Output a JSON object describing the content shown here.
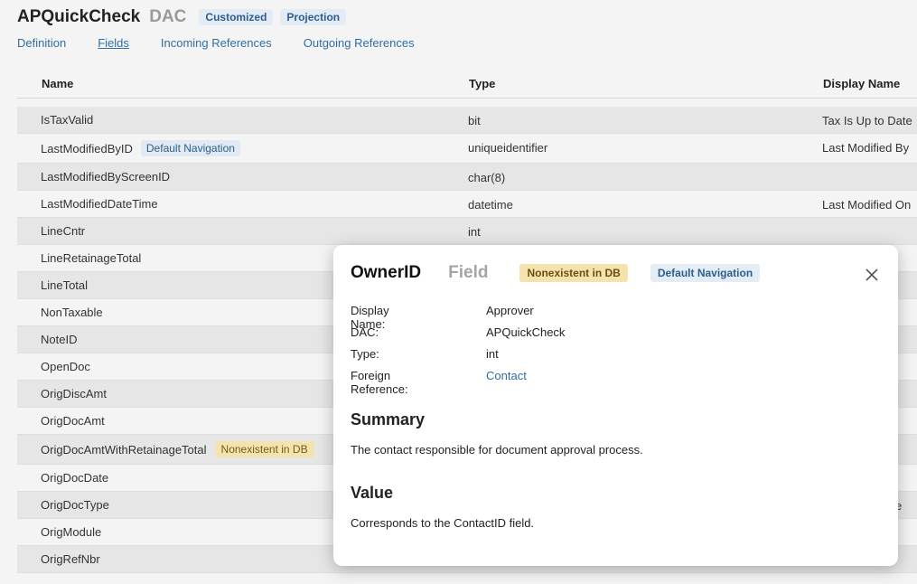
{
  "header": {
    "title": "APQuickCheck",
    "kind": "DAC",
    "tags": [
      "Customized",
      "Projection"
    ]
  },
  "tabs": [
    {
      "label": "Definition"
    },
    {
      "label": "Fields",
      "active": true
    },
    {
      "label": "Incoming References"
    },
    {
      "label": "Outgoing References"
    }
  ],
  "table": {
    "columns": [
      "Name",
      "Type",
      "Display Name"
    ],
    "rows": [
      {
        "name": "IsTaxValid",
        "badge": "",
        "type": "bit",
        "display": "Tax Is Up to Date"
      },
      {
        "name": "LastModifiedByID",
        "badge": "Default Navigation",
        "type": "uniqueidentifier",
        "display": "Last Modified By"
      },
      {
        "name": "LastModifiedByScreenID",
        "badge": "",
        "type": "char(8)",
        "display": ""
      },
      {
        "name": "LastModifiedDateTime",
        "badge": "",
        "type": "datetime",
        "display": "Last Modified On"
      },
      {
        "name": "LineCntr",
        "badge": "",
        "type": "int",
        "display": ""
      },
      {
        "name": "LineRetainageTotal",
        "badge": "",
        "type": "",
        "display": ""
      },
      {
        "name": "LineTotal",
        "badge": "",
        "type": "",
        "display": ""
      },
      {
        "name": "NonTaxable",
        "badge": "",
        "type": "",
        "display": ""
      },
      {
        "name": "NoteID",
        "badge": "",
        "type": "",
        "display": ""
      },
      {
        "name": "OpenDoc",
        "badge": "",
        "type": "",
        "display": ""
      },
      {
        "name": "OrigDiscAmt",
        "badge": "",
        "type": "",
        "display": ""
      },
      {
        "name": "OrigDocAmt",
        "badge": "",
        "type": "",
        "display": ""
      },
      {
        "name": "OrigDocAmtWithRetainageTotal",
        "badge": "Nonexistent in DB",
        "type": "",
        "display": ""
      },
      {
        "name": "OrigDocDate",
        "badge": "",
        "type": "",
        "display": ""
      },
      {
        "name": "OrigDocType",
        "badge": "",
        "type": "",
        "display": "e"
      },
      {
        "name": "OrigModule",
        "badge": "",
        "type": "",
        "display": ""
      },
      {
        "name": "OrigRefNbr",
        "badge": "",
        "type": "",
        "display": ""
      }
    ]
  },
  "modal": {
    "title": "OwnerID",
    "kind": "Field",
    "warn_badge": "Nonexistent in DB",
    "nav_badge": "Default Navigation",
    "close_icon": "close-icon",
    "properties": [
      {
        "key": "Display Name:",
        "value": "Approver"
      },
      {
        "key": "DAC:",
        "value": "APQuickCheck"
      },
      {
        "key": "Type:",
        "value": "int"
      },
      {
        "key": "Foreign Reference:",
        "value": "Contact",
        "link": true
      }
    ],
    "summary_title": "Summary",
    "summary_text": "The contact responsible for document approval process.",
    "value_title": "Value",
    "value_text": "Corresponds to the ContactID field."
  },
  "colors": {
    "link": "#2f6ea5",
    "warn_bg": "#f3e3b0",
    "nav_bg": "#e1e9f2",
    "row_alt": "#e6e6e6"
  }
}
